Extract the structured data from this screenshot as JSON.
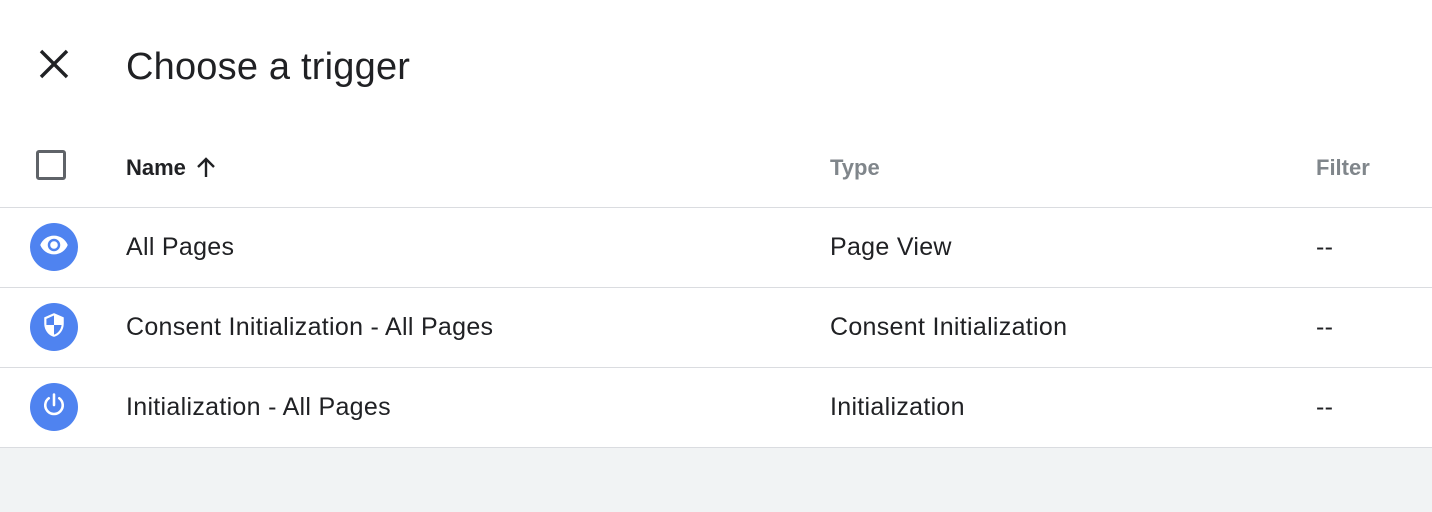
{
  "dialog": {
    "title": "Choose a trigger",
    "close_icon": "close-icon"
  },
  "table": {
    "columns": {
      "name": "Name",
      "type": "Type",
      "filter": "Filter"
    },
    "sort": {
      "column": "Name",
      "direction": "ascending",
      "icon": "arrow-up-icon"
    },
    "rows": [
      {
        "icon": "eye-icon",
        "name": "All Pages",
        "type": "Page View",
        "filter": "--"
      },
      {
        "icon": "shield-icon",
        "name": "Consent Initialization - All Pages",
        "type": "Consent Initialization",
        "filter": "--"
      },
      {
        "icon": "power-icon",
        "name": "Initialization - All Pages",
        "type": "Initialization",
        "filter": "--"
      }
    ]
  },
  "colors": {
    "icon_background": "#4f83f0",
    "border": "#dadce0",
    "footer_background": "#f1f3f4",
    "muted_text": "#80868b"
  }
}
